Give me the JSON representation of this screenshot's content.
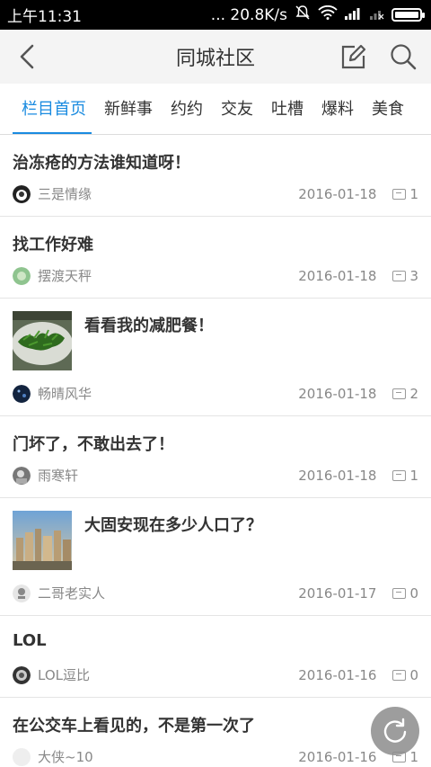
{
  "status_bar": {
    "time": "上午11:31",
    "network_speed": "... 20.8K/s"
  },
  "header": {
    "title": "同城社区",
    "back_icon": "back-arrow-icon",
    "compose_icon": "compose-icon",
    "search_icon": "search-icon"
  },
  "tabs": [
    {
      "label": "栏目首页",
      "active": true
    },
    {
      "label": "新鲜事",
      "active": false
    },
    {
      "label": "约约",
      "active": false
    },
    {
      "label": "交友",
      "active": false
    },
    {
      "label": "吐槽",
      "active": false
    },
    {
      "label": "爆料",
      "active": false
    },
    {
      "label": "美食",
      "active": false
    }
  ],
  "posts": [
    {
      "title": "治冻疮的方法谁知道呀！",
      "author": "三是情缘",
      "date": "2016-01-18",
      "comments": "1",
      "has_image": false
    },
    {
      "title": "找工作好难",
      "author": "摆渡天秤",
      "date": "2016-01-18",
      "comments": "3",
      "has_image": false
    },
    {
      "title": "看看我的减肥餐！",
      "author": "畅晴风华",
      "date": "2016-01-18",
      "comments": "2",
      "has_image": true
    },
    {
      "title": "门坏了，不敢出去了！",
      "author": "雨寒轩",
      "date": "2016-01-18",
      "comments": "1",
      "has_image": false
    },
    {
      "title": "大固安现在多少人口了？",
      "author": "二哥老实人",
      "date": "2016-01-17",
      "comments": "0",
      "has_image": true
    },
    {
      "title": "LOL",
      "author": "LOL逗比",
      "date": "2016-01-16",
      "comments": "0",
      "has_image": false
    },
    {
      "title": "在公交车上看见的，不是第一次了",
      "author": "大侠~10",
      "date": "2016-01-16",
      "comments": "1",
      "has_image": false
    }
  ],
  "colors": {
    "accent": "#1a8be0",
    "status_bar_bg": "#000000",
    "header_bg": "#f4f4f4"
  },
  "refresh_icon": "refresh-icon"
}
